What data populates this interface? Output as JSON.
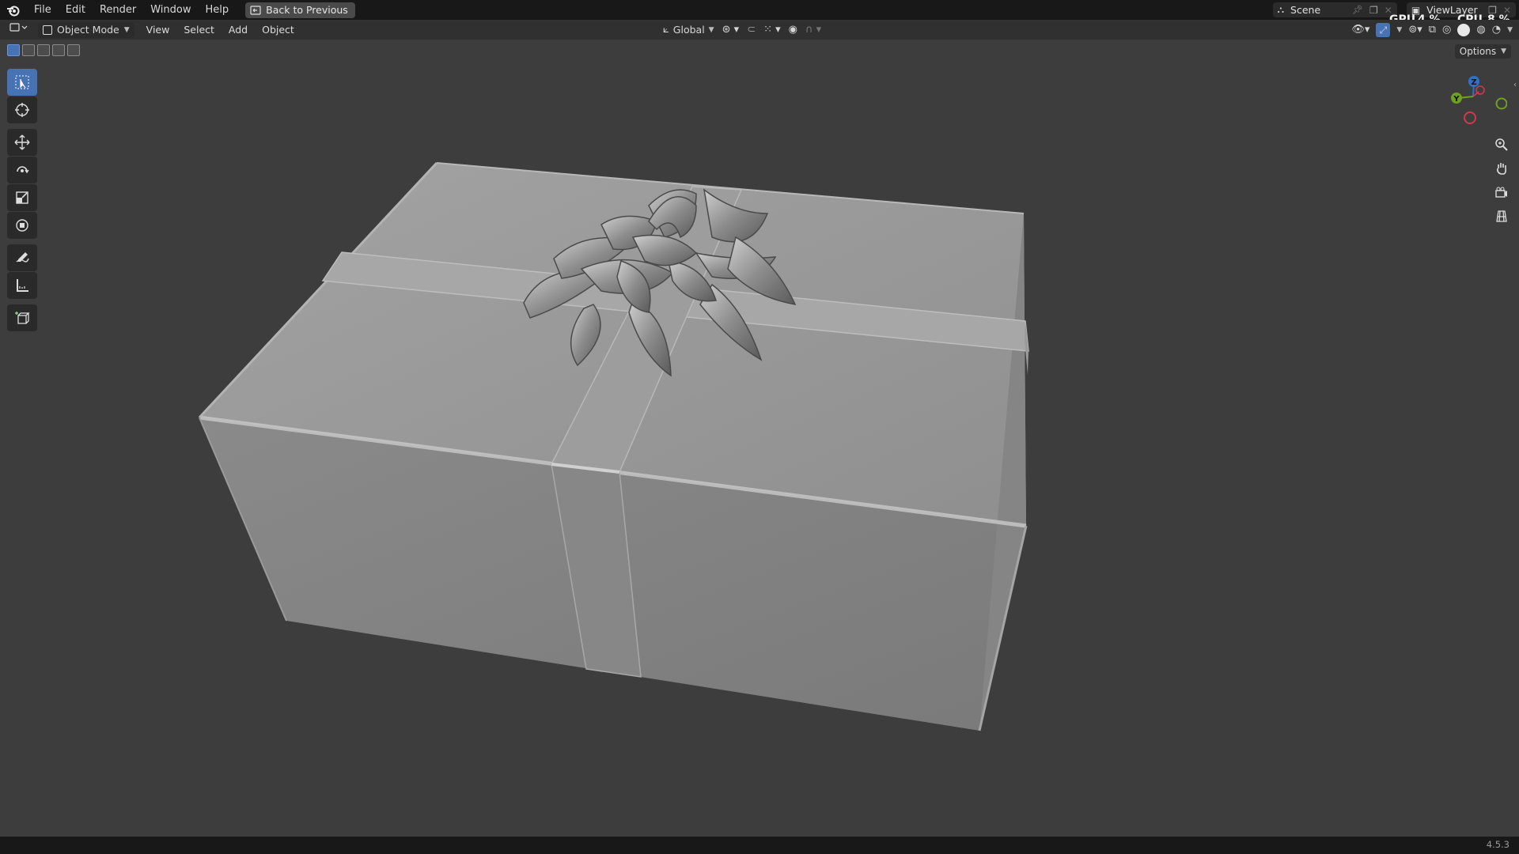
{
  "menu": {
    "items": [
      "File",
      "Edit",
      "Render",
      "Window",
      "Help"
    ],
    "back_button": "Back to Previous"
  },
  "scene": {
    "label": "Scene",
    "view_layer": "ViewLayer"
  },
  "stats": {
    "gpu_label": "GPU",
    "gpu_value": "4 %",
    "cpu_label": "CPU",
    "cpu_value": "8 %"
  },
  "header": {
    "mode": "Object Mode",
    "menus": [
      "View",
      "Select",
      "Add",
      "Object"
    ],
    "orientation": "Global"
  },
  "options_label": "Options",
  "gizmo": {
    "z": "Z",
    "y": "Y"
  },
  "status": {
    "version": "4.5.3"
  },
  "colors": {
    "accent": "#4772b3",
    "gizmo_z": "#2f6fd1",
    "gizmo_y": "#6fa120",
    "gizmo_x": "#d23a4a"
  }
}
